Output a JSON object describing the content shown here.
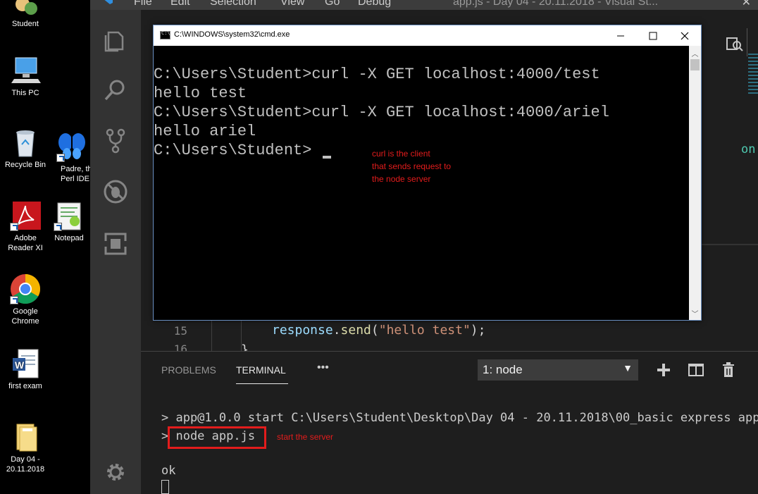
{
  "desktop": {
    "icons": [
      {
        "label": "Student",
        "icon": "user-folder-icon"
      },
      {
        "label": "This PC",
        "icon": "computer-icon"
      },
      {
        "label": "Recycle Bin",
        "icon": "recycle-bin-icon"
      },
      {
        "label": "Padre, th\nPerl IDE",
        "icon": "butterfly-icon"
      },
      {
        "label": "Adobe\nReader XI",
        "icon": "pdf-icon"
      },
      {
        "label": "Notepad",
        "icon": "notepad-icon"
      },
      {
        "label": "Google\nChrome",
        "icon": "chrome-icon"
      },
      {
        "label": "first exam",
        "icon": "word-doc-icon"
      },
      {
        "label": "Day 04 -\n20.11.2018",
        "icon": "folder-icon"
      }
    ]
  },
  "vscode": {
    "menu": [
      "File",
      "Edit",
      "Selection",
      "View",
      "Go",
      "Debug"
    ],
    "window_title": "app.js - Day 04 - 20.11.2018 - Visual St...",
    "activity_icons": [
      "explorer-icon",
      "search-icon",
      "source-control-icon",
      "debug-icon",
      "extensions-icon",
      "gear-icon"
    ],
    "editor": {
      "lines": [
        {
          "num": "15",
          "code_parts": [
            {
              "text": "response",
              "color": "#9cdcfe"
            },
            {
              "text": ".",
              "color": "#d4d4d4"
            },
            {
              "text": "send",
              "color": "#dcdcaa"
            },
            {
              "text": "(",
              "color": "#d4d4d4"
            },
            {
              "text": "\"hello test\"",
              "color": "#ce9178"
            },
            {
              "text": ");",
              "color": "#d4d4d4"
            }
          ]
        },
        {
          "num": "16",
          "code_parts": [
            {
              "text": "}",
              "color": "#d4d4d4"
            }
          ]
        }
      ],
      "partial_right_text": "on (ser"
    },
    "panel": {
      "tabs": [
        "PROBLEMS",
        "TERMINAL"
      ],
      "more": "•••",
      "terminal_select": "1: node",
      "terminal_lines": [
        "> app@1.0.0 start C:\\Users\\Student\\Desktop\\Day 04 - 20.11.2018\\00_basic express app",
        "> node app.js",
        "ok"
      ],
      "annotation": "start the server"
    }
  },
  "cmd": {
    "title": "C:\\WINDOWS\\system32\\cmd.exe",
    "lines": [
      "C:\\Users\\Student>curl -X GET localhost:4000/test",
      "hello test",
      "C:\\Users\\Student>curl -X GET localhost:4000/ariel",
      "hello ariel",
      "C:\\Users\\Student>"
    ],
    "annotation": [
      "curl is the client",
      "that sends request to",
      "the node server"
    ]
  },
  "colors": {
    "annotation_red": "#e31c1c",
    "vscode_bg": "#1e1e1e",
    "activity_bar": "#333333",
    "cmd_text": "#c0c0c0"
  }
}
